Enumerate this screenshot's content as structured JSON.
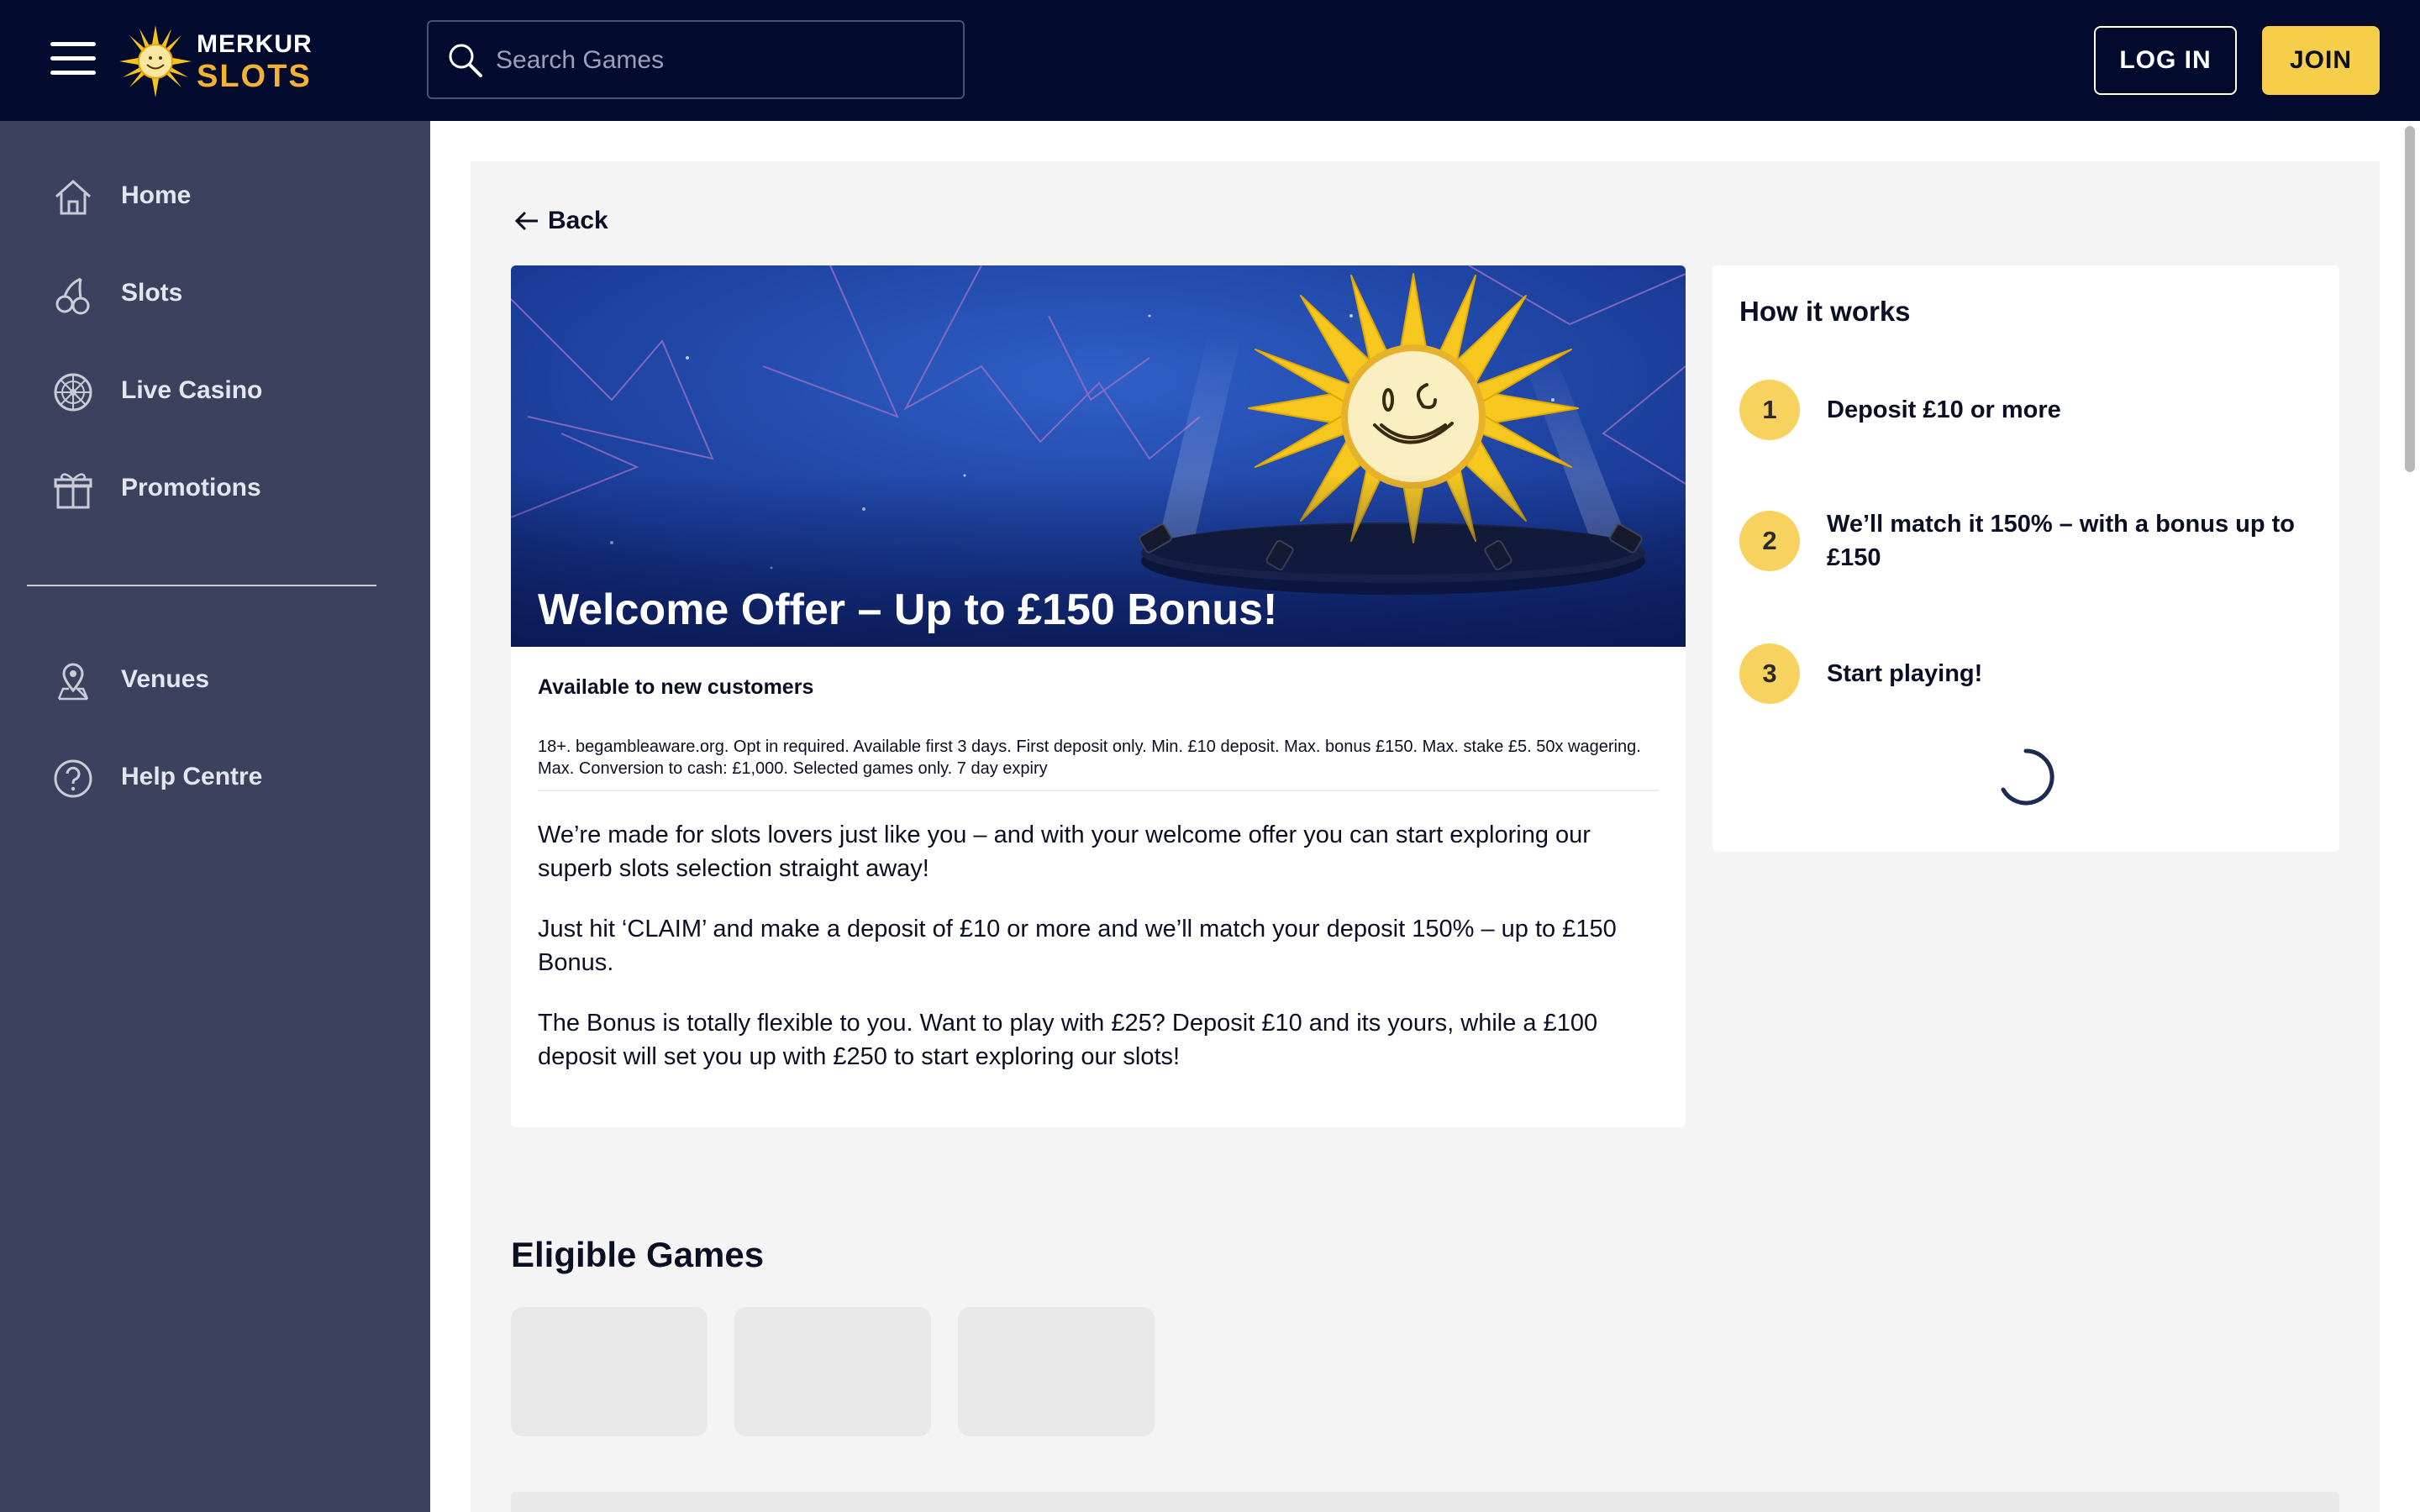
{
  "header": {
    "brand_top": "MERKUR",
    "brand_bottom": "SLOTS",
    "search_placeholder": "Search Games",
    "login_label": "LOG IN",
    "join_label": "JOIN"
  },
  "sidebar": {
    "items": [
      {
        "label": "Home",
        "icon": "home-icon"
      },
      {
        "label": "Slots",
        "icon": "cherries-icon"
      },
      {
        "label": "Live Casino",
        "icon": "roulette-wheel-icon"
      },
      {
        "label": "Promotions",
        "icon": "gift-icon"
      },
      {
        "label": "Venues",
        "icon": "location-pin-icon"
      },
      {
        "label": "Help Centre",
        "icon": "help-icon"
      }
    ]
  },
  "offer": {
    "back_label": "Back",
    "title": "Welcome Offer – Up to £150 Bonus!",
    "availability": "Available to new customers",
    "terms": "18+. begambleaware.org. Opt in required. Available first 3 days. First deposit only. Min. £10 deposit. Max. bonus £150. Max. stake £5. 50x wagering. Max. Conversion to cash: £1,000. Selected games only. 7 day expiry",
    "paragraphs": [
      "We’re made for slots lovers just like you – and with your welcome offer you can start exploring our superb slots selection straight away!",
      "Just hit ‘CLAIM’ and make a deposit of £10 or more and we’ll match your deposit 150% – up to £150 Bonus.",
      "The Bonus is totally flexible to you. Want to play with £25? Deposit £10 and its yours, while a £100 deposit will set you up with £250 to start exploring our slots!"
    ]
  },
  "how_it_works": {
    "title": "How it works",
    "steps": [
      {
        "num": "1",
        "text": "Deposit £10 or more"
      },
      {
        "num": "2",
        "text": "We’ll match it 150% – with a bonus up to £150"
      },
      {
        "num": "3",
        "text": "Start playing!"
      }
    ]
  },
  "eligible_games": {
    "title": "Eligible Games"
  },
  "colors": {
    "header_bg": "#020b2e",
    "sidebar_bg": "#3c425e",
    "join_yellow": "#f7ce4a",
    "step_yellow": "#f7d25e",
    "banner_blue": "#1b3fa0"
  }
}
